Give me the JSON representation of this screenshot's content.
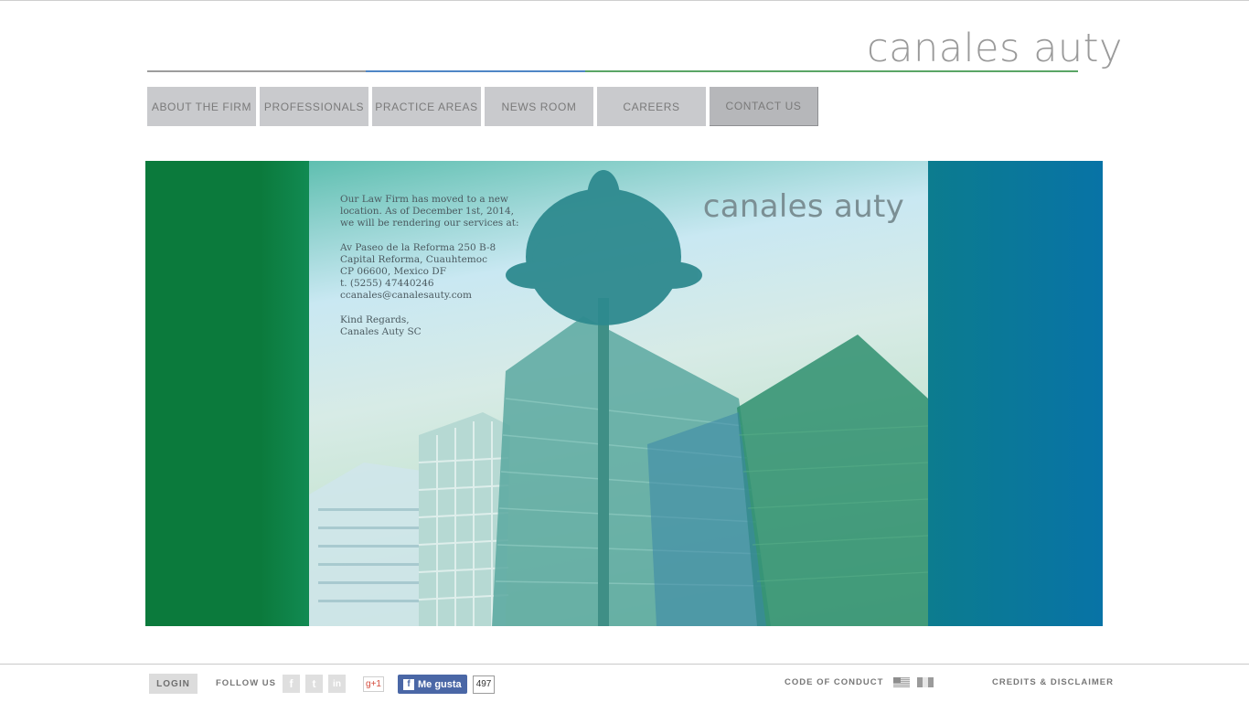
{
  "header": {
    "logo": "canales auty"
  },
  "nav": {
    "items": [
      {
        "label": "ABOUT THE FIRM"
      },
      {
        "label": "PROFESSIONALS"
      },
      {
        "label": "PRACTICE AREAS"
      },
      {
        "label": "NEWS ROOM"
      },
      {
        "label": "CAREERS"
      },
      {
        "label": "CONTACT US",
        "active": true
      }
    ]
  },
  "hero": {
    "logo": "canales auty",
    "notice": "Our Law Firm has moved to a new location. As of December 1st, 2014, we will be rendering our services at:",
    "address_line1": "Av Paseo de la Reforma 250 B-8",
    "address_line2": "Capital Reforma, Cuauhtemoc",
    "address_line3": "CP 06600, Mexico DF",
    "phone": "t. (5255) 47440246",
    "email": "ccanales@canalesauty.com",
    "regards": "Kind Regards,",
    "signature": "Canales Auty SC"
  },
  "footer": {
    "login": "LOGIN",
    "follow_us": "FOLLOW US",
    "social": {
      "facebook": "f",
      "twitter": "t",
      "linkedin": "in",
      "gplus": "g+1"
    },
    "fb_like_label": "Me gusta",
    "fb_like_count": "497",
    "code_of_conduct": "CODE OF CONDUCT",
    "credits": "CREDITS & DISCLAIMER"
  },
  "colors": {
    "green": "#0b7a3c",
    "blue": "#0873a6",
    "nav_gray": "#c9cacd"
  }
}
